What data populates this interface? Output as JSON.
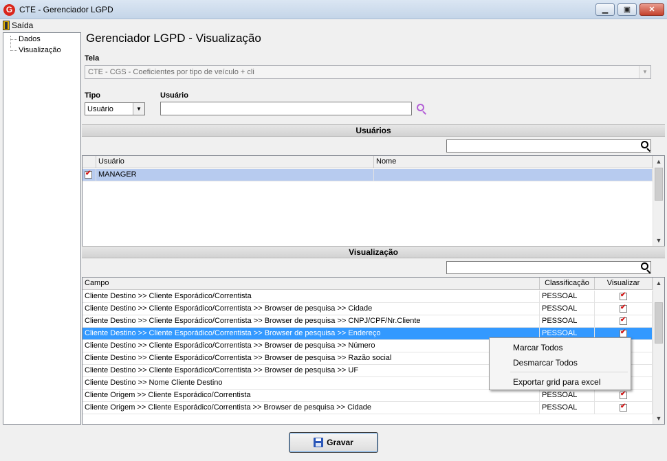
{
  "window": {
    "title": "CTE - Gerenciador LGPD",
    "app_icon": "G",
    "minimize": "▁",
    "maximize": "▣",
    "close": "✕"
  },
  "menu": {
    "exit_label": "Saída"
  },
  "tree": {
    "items": [
      "Dados",
      "Visualização"
    ]
  },
  "page": {
    "title": "Gerenciador LGPD - Visualização"
  },
  "tela": {
    "label": "Tela",
    "value": "CTE - CGS - Coeficientes por tipo de veículo + cli"
  },
  "tipo": {
    "label": "Tipo",
    "value": "Usuário"
  },
  "usuario": {
    "label": "Usuário",
    "value": ""
  },
  "usuarios_section": {
    "title": "Usuários",
    "search_value": "",
    "columns": [
      "Usuário",
      "Nome"
    ],
    "rows": [
      {
        "checked": true,
        "usuario": "MANAGER",
        "nome": ""
      }
    ]
  },
  "visualizacao_section": {
    "title": "Visualização",
    "search_value": "",
    "columns": [
      "Campo",
      "Classificação",
      "Visualizar"
    ],
    "rows": [
      {
        "campo": "Cliente Destino >> Cliente Esporádico/Correntista",
        "classificacao": "PESSOAL",
        "visualizar": true
      },
      {
        "campo": "Cliente Destino >> Cliente Esporádico/Correntista >> Browser de pesquisa >> Cidade",
        "classificacao": "PESSOAL",
        "visualizar": true
      },
      {
        "campo": "Cliente Destino >> Cliente Esporádico/Correntista >> Browser de pesquisa >> CNPJ/CPF/Nr.Cliente",
        "classificacao": "PESSOAL",
        "visualizar": true
      },
      {
        "campo": "Cliente Destino >> Cliente Esporádico/Correntista >> Browser de pesquisa >> Endereço",
        "classificacao": "PESSOAL",
        "visualizar": true
      },
      {
        "campo": "Cliente Destino >> Cliente Esporádico/Correntista >> Browser de pesquisa >> Número",
        "classificacao": "",
        "visualizar": null
      },
      {
        "campo": "Cliente Destino >> Cliente Esporádico/Correntista >> Browser de pesquisa >> Razão social",
        "classificacao": "",
        "visualizar": null
      },
      {
        "campo": "Cliente Destino >> Cliente Esporádico/Correntista >> Browser de pesquisa >> UF",
        "classificacao": "",
        "visualizar": null
      },
      {
        "campo": "Cliente Destino >> Nome Cliente Destino",
        "classificacao": "",
        "visualizar": null
      },
      {
        "campo": "Cliente Origem >> Cliente Esporádico/Correntista",
        "classificacao": "PESSOAL",
        "visualizar": true
      },
      {
        "campo": "Cliente Origem >> Cliente Esporádico/Correntista >> Browser de pesquisa >> Cidade",
        "classificacao": "PESSOAL",
        "visualizar": true
      }
    ],
    "selected_row": 3
  },
  "context_menu": {
    "items": [
      "Marcar Todos",
      "Desmarcar Todos",
      "Exportar grid para excel"
    ]
  },
  "footer": {
    "save_label": "Gravar"
  },
  "colors": {
    "accent": "#3399ff",
    "check": "#d21414",
    "search_icon": "#b35fd6"
  }
}
